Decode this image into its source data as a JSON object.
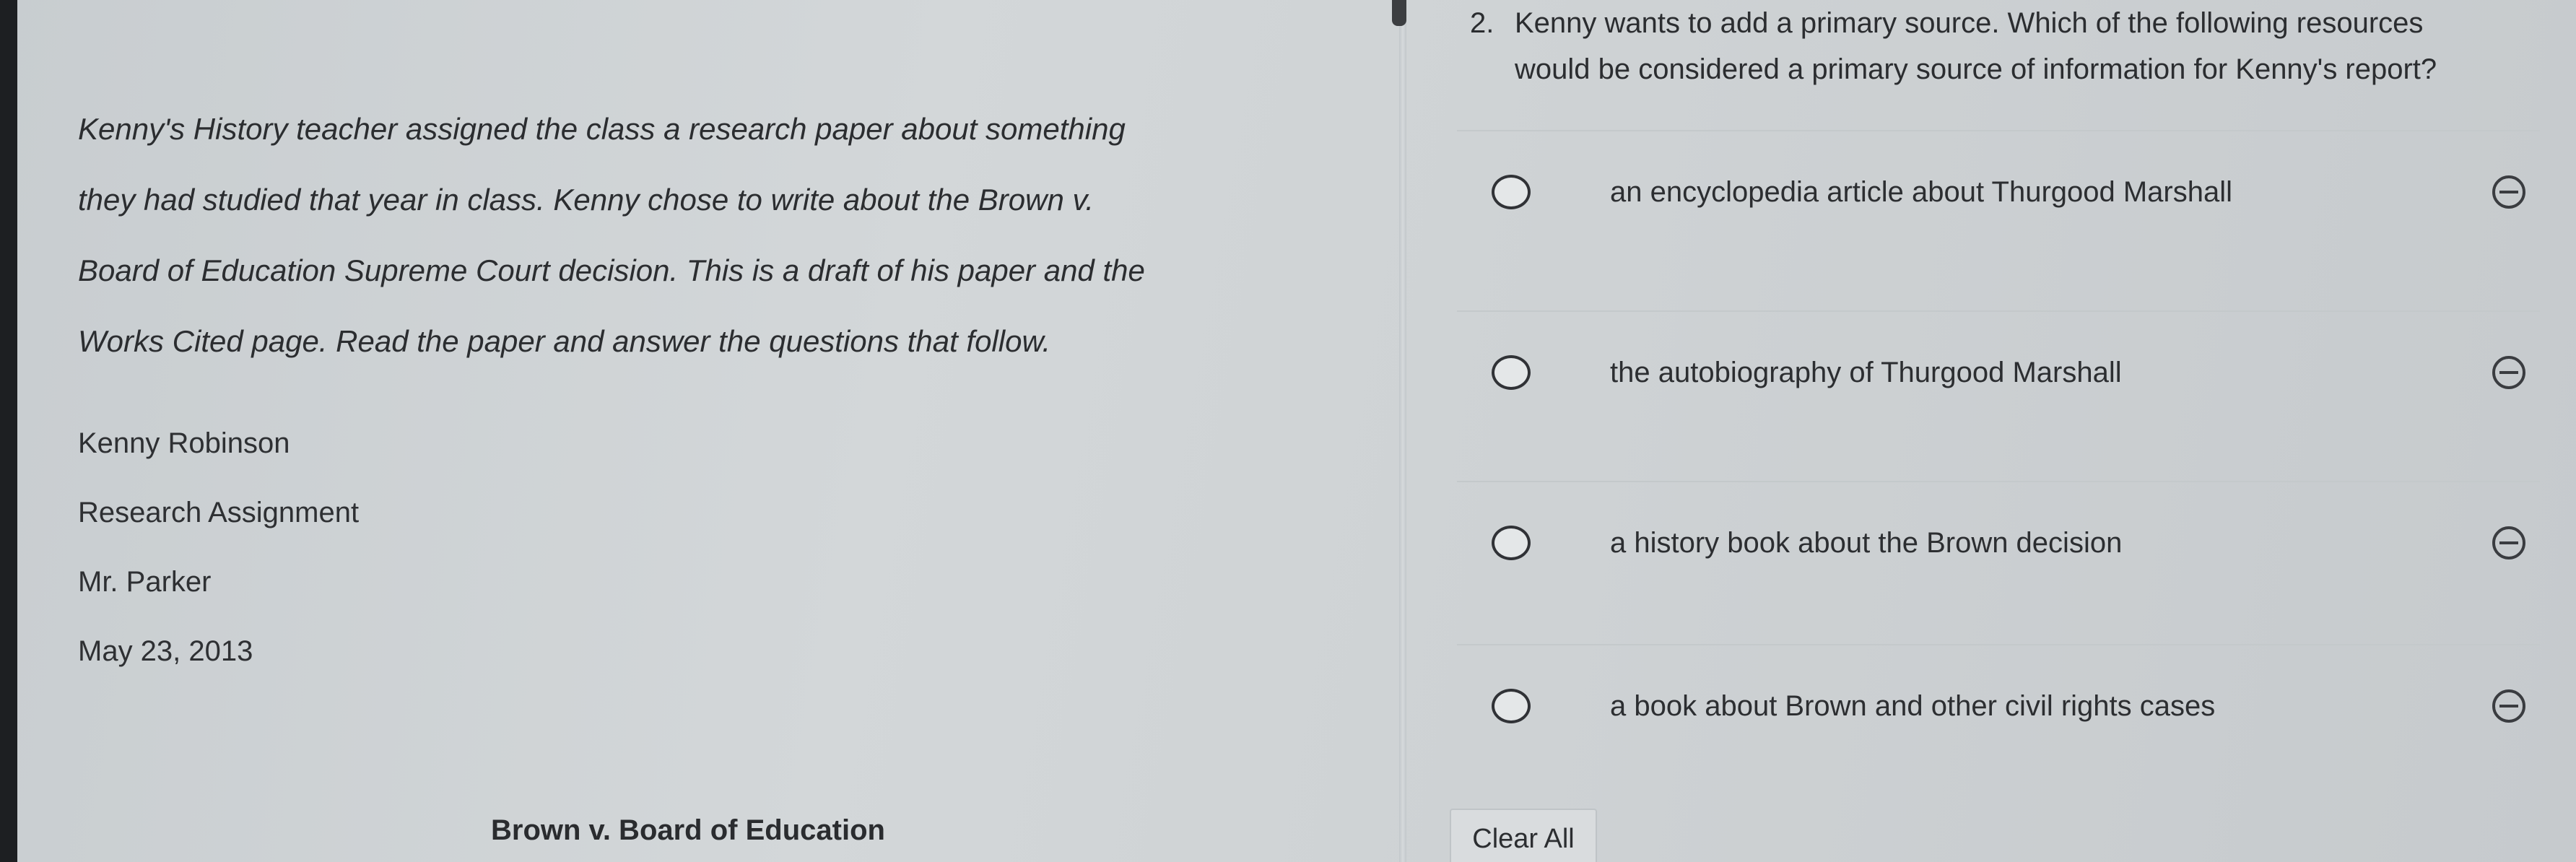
{
  "passage": {
    "intro_lines": [
      "Kenny's History teacher assigned the class a research paper about something",
      "they had studied that year in class. Kenny chose to write about the Brown v.",
      "Board of Education Supreme Court decision. This is a draft of his paper and the",
      "Works Cited page. Read the paper and answer the questions that follow."
    ],
    "author": "Kenny Robinson",
    "assignment": "Research Assignment",
    "teacher": "Mr. Parker",
    "date": "May 23, 2013",
    "paper_title": "Brown v. Board of Education"
  },
  "question": {
    "number": "2.",
    "line1": "Kenny wants to add a primary source. Which of the following resources",
    "line2": "would be considered a primary source of information for Kenny's report?"
  },
  "options": [
    {
      "text": "an encyclopedia article about Thurgood Marshall",
      "selected": false
    },
    {
      "text": "the autobiography of Thurgood Marshall",
      "selected": false
    },
    {
      "text": "a history book about the Brown decision",
      "selected": false
    },
    {
      "text": "a book about Brown and other civil rights cases",
      "selected": false
    }
  ],
  "controls": {
    "clear_all_label": "Clear All"
  },
  "icons": {
    "radio": "radio-button-icon",
    "eliminate": "eliminate-option-icon"
  }
}
